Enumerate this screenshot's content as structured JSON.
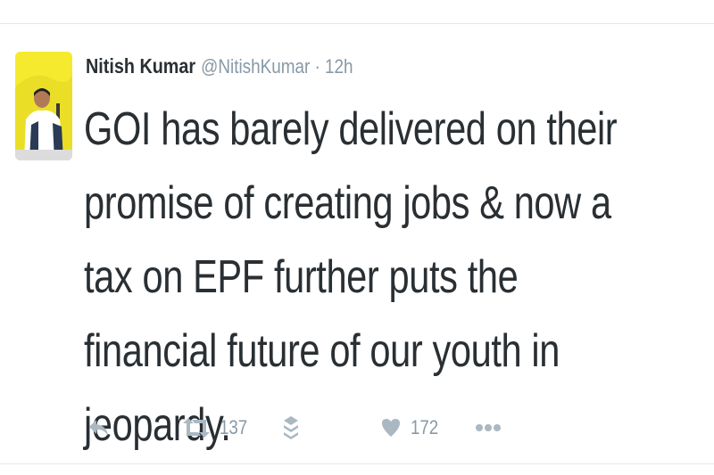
{
  "tweet": {
    "author_name": "Nitish Kumar",
    "author_handle": "@NitishKumar",
    "separator": "·",
    "time": "12h",
    "text": "GOI has barely delivered on their promise of creating jobs & now a tax on EPF further puts the financial future of our youth in jeopardy."
  },
  "actions": {
    "retweet_count": "137",
    "like_count": "172"
  },
  "icons": [
    "reply-icon",
    "retweet-icon",
    "buffer-icon",
    "heart-icon",
    "more-icon"
  ],
  "colors": {
    "avatar_bg": "#f3e93a",
    "icon": "#aab8c2",
    "text": "#292f33",
    "muted": "#8899a6"
  }
}
